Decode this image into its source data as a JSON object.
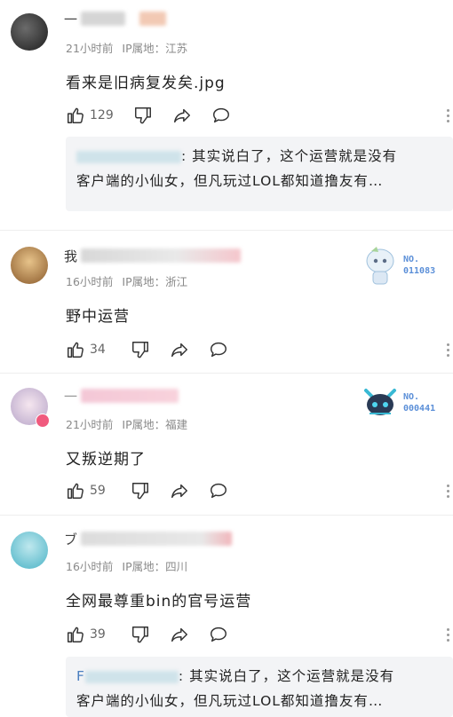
{
  "comments": [
    {
      "time": "21小时前",
      "ip": "IP属地：江苏",
      "text": "看来是旧病复发矣.jpg",
      "likes": "129",
      "reply": {
        "name": "",
        "text": ": 其实说白了，这个运营就是没有",
        "text2": "客户端的小仙女，但凡玩过LOL都知道撸友有…"
      }
    },
    {
      "name_prefix": "我",
      "time": "16小时前",
      "ip": "IP属地：浙江",
      "text": "野中运营",
      "likes": "34",
      "badge": {
        "label": "NO.",
        "number": "011083"
      }
    },
    {
      "time": "21小时前",
      "ip": "IP属地：福建",
      "text": "又叛逆期了",
      "likes": "59",
      "badge": {
        "label": "NO.",
        "number": "000441"
      }
    },
    {
      "time": "16小时前",
      "ip": "IP属地：四川",
      "text": "全网最尊重bin的官号运营",
      "likes": "39",
      "reply": {
        "name": "F",
        "text": ": 其实说白了，这个运营就是没有",
        "text2": "客户端的小仙女，但凡玩过LOL都知道撸友有…"
      }
    }
  ],
  "icons": {
    "like": "thumbs-up-icon",
    "dislike": "thumbs-down-icon",
    "share": "share-icon",
    "comment": "comment-icon",
    "more": "more-vertical-icon"
  },
  "colors": {
    "reply_name": "#4a7fc0",
    "meta": "#8a8a8a",
    "badge": "#5b8fd8"
  }
}
